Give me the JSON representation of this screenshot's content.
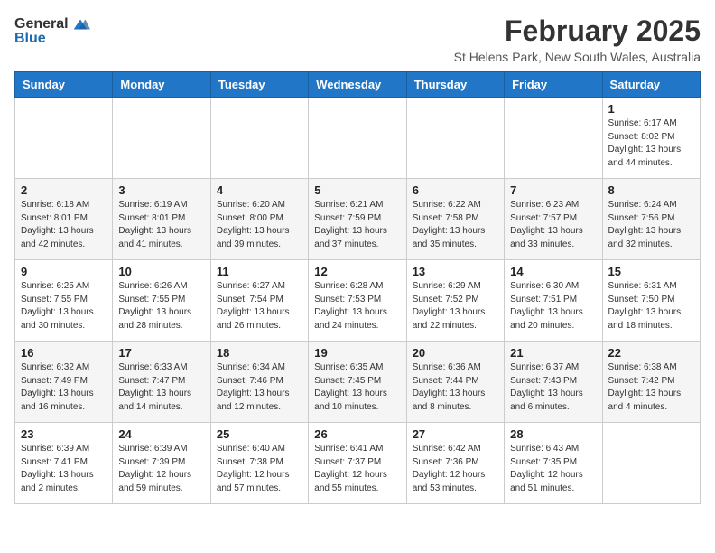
{
  "header": {
    "logo_general": "General",
    "logo_blue": "Blue",
    "title": "February 2025",
    "subtitle": "St Helens Park, New South Wales, Australia"
  },
  "weekdays": [
    "Sunday",
    "Monday",
    "Tuesday",
    "Wednesday",
    "Thursday",
    "Friday",
    "Saturday"
  ],
  "weeks": [
    [
      {
        "day": "",
        "info": ""
      },
      {
        "day": "",
        "info": ""
      },
      {
        "day": "",
        "info": ""
      },
      {
        "day": "",
        "info": ""
      },
      {
        "day": "",
        "info": ""
      },
      {
        "day": "",
        "info": ""
      },
      {
        "day": "1",
        "info": "Sunrise: 6:17 AM\nSunset: 8:02 PM\nDaylight: 13 hours\nand 44 minutes."
      }
    ],
    [
      {
        "day": "2",
        "info": "Sunrise: 6:18 AM\nSunset: 8:01 PM\nDaylight: 13 hours\nand 42 minutes."
      },
      {
        "day": "3",
        "info": "Sunrise: 6:19 AM\nSunset: 8:01 PM\nDaylight: 13 hours\nand 41 minutes."
      },
      {
        "day": "4",
        "info": "Sunrise: 6:20 AM\nSunset: 8:00 PM\nDaylight: 13 hours\nand 39 minutes."
      },
      {
        "day": "5",
        "info": "Sunrise: 6:21 AM\nSunset: 7:59 PM\nDaylight: 13 hours\nand 37 minutes."
      },
      {
        "day": "6",
        "info": "Sunrise: 6:22 AM\nSunset: 7:58 PM\nDaylight: 13 hours\nand 35 minutes."
      },
      {
        "day": "7",
        "info": "Sunrise: 6:23 AM\nSunset: 7:57 PM\nDaylight: 13 hours\nand 33 minutes."
      },
      {
        "day": "8",
        "info": "Sunrise: 6:24 AM\nSunset: 7:56 PM\nDaylight: 13 hours\nand 32 minutes."
      }
    ],
    [
      {
        "day": "9",
        "info": "Sunrise: 6:25 AM\nSunset: 7:55 PM\nDaylight: 13 hours\nand 30 minutes."
      },
      {
        "day": "10",
        "info": "Sunrise: 6:26 AM\nSunset: 7:55 PM\nDaylight: 13 hours\nand 28 minutes."
      },
      {
        "day": "11",
        "info": "Sunrise: 6:27 AM\nSunset: 7:54 PM\nDaylight: 13 hours\nand 26 minutes."
      },
      {
        "day": "12",
        "info": "Sunrise: 6:28 AM\nSunset: 7:53 PM\nDaylight: 13 hours\nand 24 minutes."
      },
      {
        "day": "13",
        "info": "Sunrise: 6:29 AM\nSunset: 7:52 PM\nDaylight: 13 hours\nand 22 minutes."
      },
      {
        "day": "14",
        "info": "Sunrise: 6:30 AM\nSunset: 7:51 PM\nDaylight: 13 hours\nand 20 minutes."
      },
      {
        "day": "15",
        "info": "Sunrise: 6:31 AM\nSunset: 7:50 PM\nDaylight: 13 hours\nand 18 minutes."
      }
    ],
    [
      {
        "day": "16",
        "info": "Sunrise: 6:32 AM\nSunset: 7:49 PM\nDaylight: 13 hours\nand 16 minutes."
      },
      {
        "day": "17",
        "info": "Sunrise: 6:33 AM\nSunset: 7:47 PM\nDaylight: 13 hours\nand 14 minutes."
      },
      {
        "day": "18",
        "info": "Sunrise: 6:34 AM\nSunset: 7:46 PM\nDaylight: 13 hours\nand 12 minutes."
      },
      {
        "day": "19",
        "info": "Sunrise: 6:35 AM\nSunset: 7:45 PM\nDaylight: 13 hours\nand 10 minutes."
      },
      {
        "day": "20",
        "info": "Sunrise: 6:36 AM\nSunset: 7:44 PM\nDaylight: 13 hours\nand 8 minutes."
      },
      {
        "day": "21",
        "info": "Sunrise: 6:37 AM\nSunset: 7:43 PM\nDaylight: 13 hours\nand 6 minutes."
      },
      {
        "day": "22",
        "info": "Sunrise: 6:38 AM\nSunset: 7:42 PM\nDaylight: 13 hours\nand 4 minutes."
      }
    ],
    [
      {
        "day": "23",
        "info": "Sunrise: 6:39 AM\nSunset: 7:41 PM\nDaylight: 13 hours\nand 2 minutes."
      },
      {
        "day": "24",
        "info": "Sunrise: 6:39 AM\nSunset: 7:39 PM\nDaylight: 12 hours\nand 59 minutes."
      },
      {
        "day": "25",
        "info": "Sunrise: 6:40 AM\nSunset: 7:38 PM\nDaylight: 12 hours\nand 57 minutes."
      },
      {
        "day": "26",
        "info": "Sunrise: 6:41 AM\nSunset: 7:37 PM\nDaylight: 12 hours\nand 55 minutes."
      },
      {
        "day": "27",
        "info": "Sunrise: 6:42 AM\nSunset: 7:36 PM\nDaylight: 12 hours\nand 53 minutes."
      },
      {
        "day": "28",
        "info": "Sunrise: 6:43 AM\nSunset: 7:35 PM\nDaylight: 12 hours\nand 51 minutes."
      },
      {
        "day": "",
        "info": ""
      }
    ]
  ]
}
